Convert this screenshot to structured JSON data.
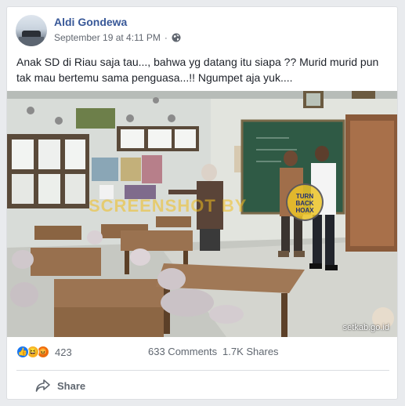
{
  "post": {
    "author": "Aldi Gondewa",
    "timestamp": "September 19 at 4:11 PM",
    "separator": "·",
    "privacy_icon": "globe-icon",
    "text": "Anak SD di Riau saja tau..., bahwa yg datang itu siapa ?? Murid murid pun tak mau bertemu sama penguasa...!! Ngumpet aja yuk....",
    "image": {
      "watermark": "SCREENSHOT BY",
      "badge_lines": [
        "TURN",
        "BACK",
        "HOAX"
      ],
      "credit": "setkab.go.id"
    }
  },
  "stats": {
    "reaction_icons": [
      "like-icon",
      "haha-icon",
      "angry-icon"
    ],
    "reaction_count": "423",
    "comments": "633 Comments",
    "shares": "1.7K Shares"
  },
  "actions": {
    "share_label": "Share"
  },
  "colors": {
    "author_link": "#385898",
    "background": "#e9ebee",
    "like_blue": "#1877f2"
  }
}
